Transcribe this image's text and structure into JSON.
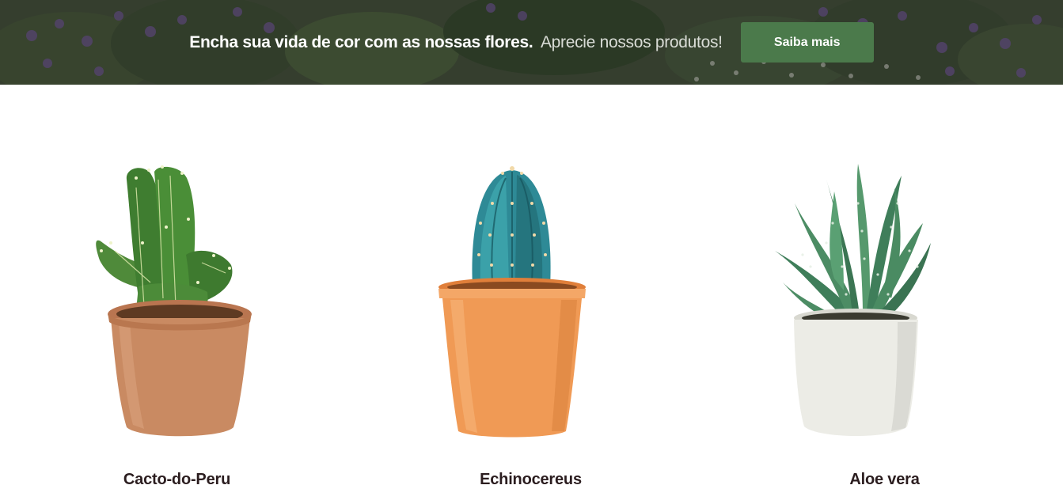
{
  "banner": {
    "headline_strong": "Encha sua vida de cor com as nossas flores.",
    "headline_light": "Aprecie nossos produtos!",
    "cta_label": "Saiba mais",
    "cta_color": "#4b7a4b"
  },
  "products": [
    {
      "name": "Cacto-do-Peru",
      "image": "cactus-peru-icon"
    },
    {
      "name": "Echinocereus",
      "image": "echinocereus-icon"
    },
    {
      "name": "Aloe vera",
      "image": "aloe-vera-icon"
    }
  ],
  "colors": {
    "terracotta_pot": "#c98a62",
    "orange_pot": "#f09a55",
    "white_pot": "#ecece6",
    "text_dark": "#2b1d1f"
  }
}
